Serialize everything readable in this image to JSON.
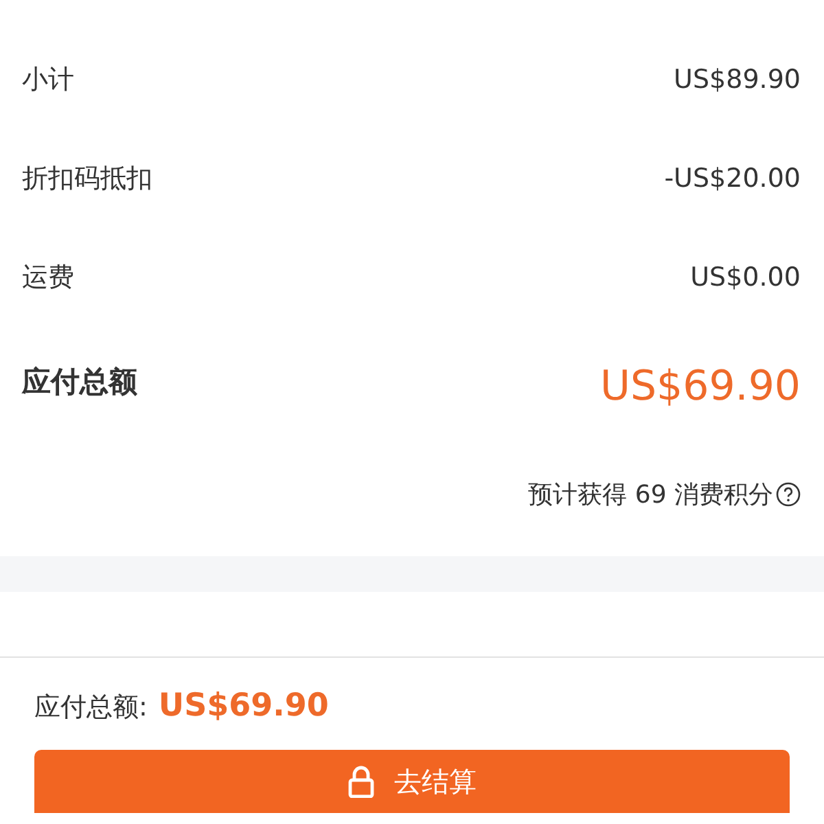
{
  "summary_rows": [
    {
      "label": "小计",
      "value": "US$89.90"
    },
    {
      "label": "折扣码抵扣",
      "value": "-US$20.00"
    },
    {
      "label": "运费",
      "value": "US$0.00"
    }
  ],
  "total": {
    "label": "应付总额",
    "value": "US$69.90"
  },
  "points_note": "预计获得 69 消费积分",
  "checkout_bar": {
    "label": "应付总额:",
    "value": "US$69.90",
    "button": "去结算"
  }
}
